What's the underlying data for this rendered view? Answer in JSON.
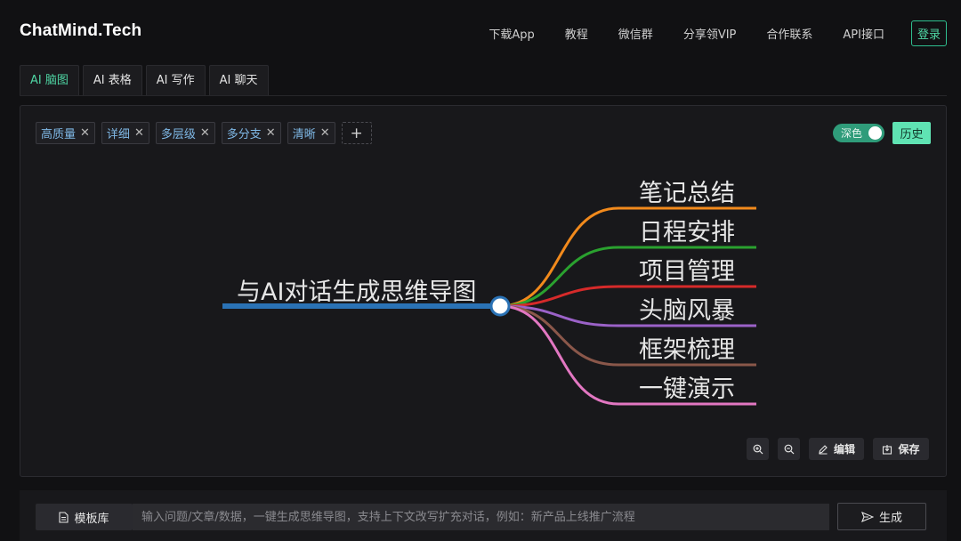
{
  "brand": "ChatMind.Tech",
  "nav": {
    "items": [
      "下载App",
      "教程",
      "微信群",
      "分享领VIP",
      "合作联系",
      "API接口"
    ],
    "login": "登录"
  },
  "tabs": [
    "AI 脑图",
    "AI 表格",
    "AI 写作",
    "AI 聊天"
  ],
  "active_tab": "AI 脑图",
  "tags": [
    "高质量",
    "详细",
    "多层级",
    "多分支",
    "清晰"
  ],
  "theme_toggle": {
    "label": "深色",
    "on": true
  },
  "history_label": "历史",
  "mindmap": {
    "root": "与AI对话生成思维导图",
    "root_color": "#2a72b5",
    "branches": [
      {
        "label": "笔记总结",
        "color": "#f28a1c"
      },
      {
        "label": "日程安排",
        "color": "#2aa12f"
      },
      {
        "label": "项目管理",
        "color": "#d62a2a"
      },
      {
        "label": "头脑风暴",
        "color": "#9b62c8"
      },
      {
        "label": "框架梳理",
        "color": "#8a574a"
      },
      {
        "label": "一键演示",
        "color": "#e277c2"
      }
    ]
  },
  "toolbar": {
    "edit_label": "编辑",
    "save_label": "保存"
  },
  "bottom": {
    "template_label": "模板库",
    "placeholder": "输入问题/文章/数据，一键生成思维导图，支持上下文改写扩充对话，例如：新产品上线推广流程",
    "generate_label": "生成"
  },
  "colors": {
    "accent": "#4fd6a4",
    "history_bg": "#5fe3b3",
    "toggle_bg": "#2f9c7a",
    "tag_text": "#7fb8e6"
  }
}
